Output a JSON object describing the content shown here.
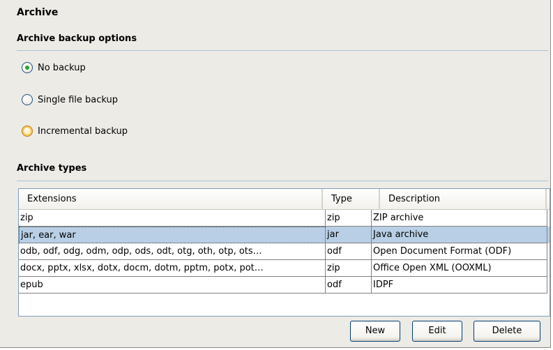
{
  "panel": {
    "title": "Archive"
  },
  "backup": {
    "heading": "Archive backup options",
    "options": [
      {
        "label": "No backup",
        "checked": true
      },
      {
        "label": "Single file backup",
        "checked": false
      },
      {
        "label": "Incremental backup",
        "checked": false
      }
    ]
  },
  "types": {
    "heading": "Archive types",
    "columns": [
      "Extensions",
      "Type",
      "Description"
    ],
    "rows": [
      {
        "ext": "zip",
        "type": "zip",
        "desc": "ZIP archive"
      },
      {
        "ext": "jar, ear, war",
        "type": "jar",
        "desc": "Java archive"
      },
      {
        "ext": "odb, odf, odg, odm, odp, ods, odt, otg, oth, otp, ots…",
        "type": "odf",
        "desc": "Open Document Format (ODF)"
      },
      {
        "ext": "docx, pptx, xlsx, dotx, docm, dotm, pptm, potx, pot…",
        "type": "zip",
        "desc": "Office Open XML (OOXML)"
      },
      {
        "ext": "epub",
        "type": "odf",
        "desc": "IDPF"
      }
    ],
    "selected_row": "jar, ear, war"
  },
  "buttons": {
    "new": "New",
    "edit": "Edit",
    "delete": "Delete"
  }
}
